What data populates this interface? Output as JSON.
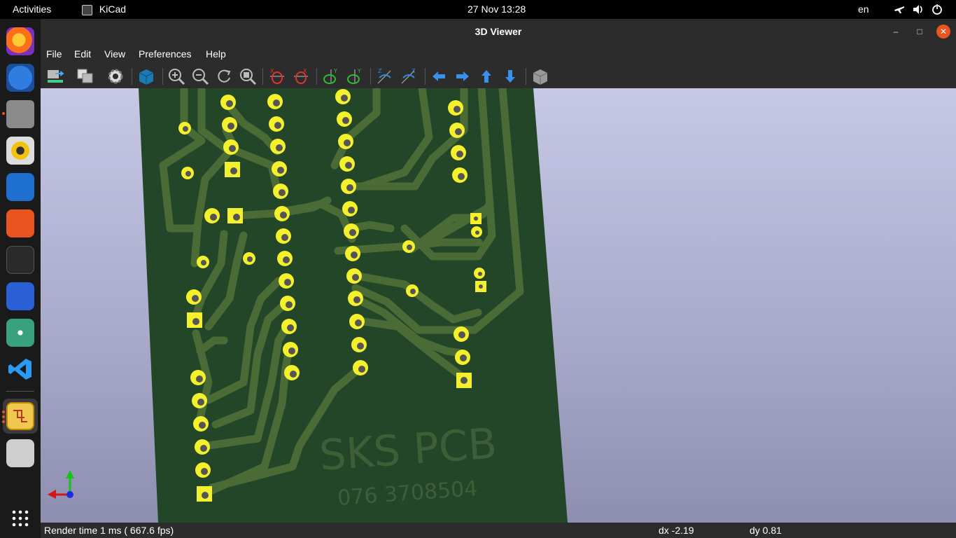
{
  "topbar": {
    "activities": "Activities",
    "app_name": "KiCad",
    "datetime": "27 Nov  13:28",
    "lang": "en"
  },
  "window": {
    "title": "3D Viewer"
  },
  "menu": [
    "File",
    "Edit",
    "View",
    "Preferences",
    "Help"
  ],
  "toolbar_icons": [
    "reload-board-icon",
    "copy-image-icon",
    "raytracing-settings-icon",
    "3d-render-icon",
    "zoom-in-icon",
    "zoom-out-icon",
    "redraw-icon",
    "zoom-fit-icon",
    "rotate-x-cw-icon",
    "rotate-x-ccw-icon",
    "rotate-y-cw-icon",
    "rotate-y-ccw-icon",
    "rotate-z-cw-icon",
    "rotate-z-ccw-icon",
    "pan-left-icon",
    "pan-right-icon",
    "pan-up-icon",
    "pan-down-icon",
    "ortho-view-icon"
  ],
  "board": {
    "silkscreen_title": "SKS PCB",
    "silkscreen_phone": "076 3708504"
  },
  "status": {
    "render_time": "Render time 1 ms ( 667.6 fps)",
    "dx": "dx -2.19",
    "dy": "dy 0.81"
  },
  "colors": {
    "board": "#244628",
    "trace": "#4b6b36",
    "pad": "#f4f02c",
    "accent": "#e95420"
  }
}
